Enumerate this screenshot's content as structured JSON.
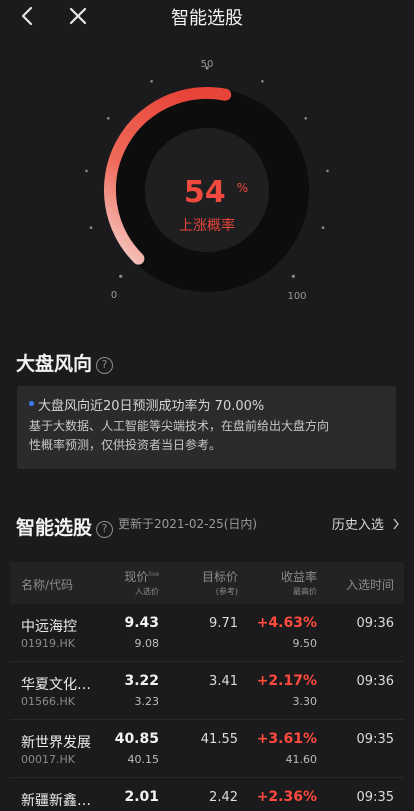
{
  "nav": {
    "title": "智能选股"
  },
  "gauge": {
    "value": 54,
    "value_text": "54",
    "unit": "%",
    "label": "上涨概率",
    "tick_top": "50",
    "tick_left": "0",
    "tick_right": "100",
    "accent": "#e8453a"
  },
  "market": {
    "title": "大盘风向",
    "headline": "大盘风向近20日预测成功率为 70.00%",
    "desc_1": "基于大数据、人工智能等尖端技术，在盘前给出大盘方向",
    "desc_2": "性概率预测，仅供投资者当日参考。"
  },
  "picks": {
    "title": "智能选股",
    "updated": "更新于2021-02-25(日内)",
    "history": "历史入选",
    "headers": {
      "name": "名称/代码",
      "price": "现价",
      "price_sup": "live",
      "price_sub": "入选价",
      "target": "目标价",
      "target_sub": "(参考)",
      "yield": "收益率",
      "yield_sub": "最高价",
      "time": "入选时间"
    },
    "rows": [
      {
        "name": "中远海控",
        "code": "01919.HK",
        "price": "9.43",
        "entry": "9.08",
        "target": "9.71",
        "yield": "+4.63%",
        "high": "9.50",
        "time": "09:36"
      },
      {
        "name": "华夏文化…",
        "code": "01566.HK",
        "price": "3.22",
        "entry": "3.23",
        "target": "3.41",
        "yield": "+2.17%",
        "high": "3.30",
        "time": "09:36"
      },
      {
        "name": "新世界发展",
        "code": "00017.HK",
        "price": "40.85",
        "entry": "40.15",
        "target": "41.55",
        "yield": "+3.61%",
        "high": "41.60",
        "time": "09:35"
      },
      {
        "name": "新疆新鑫…",
        "code": "",
        "price": "2.01",
        "entry": "",
        "target": "2.42",
        "yield": "+2.36%",
        "high": "",
        "time": "09:35"
      }
    ]
  }
}
